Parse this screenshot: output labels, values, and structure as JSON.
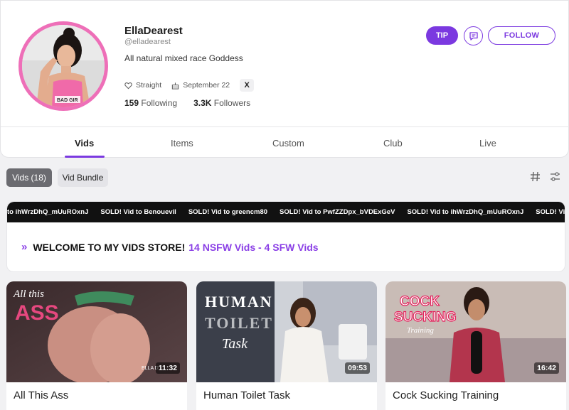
{
  "profile": {
    "name": "EllaDearest",
    "handle": "@elladearest",
    "bio": "All natural mixed race Goddess",
    "orientation": "Straight",
    "birthday": "September 22",
    "social": "X",
    "following_count": "159",
    "following_label": "Following",
    "followers_count": "3.3K",
    "followers_label": "Followers",
    "avatar_shirt_text": "BAD GIR"
  },
  "actions": {
    "tip": "TIP",
    "follow": "FOLLOW"
  },
  "tabs": [
    {
      "label": "Vids",
      "active": true
    },
    {
      "label": "Items"
    },
    {
      "label": "Custom"
    },
    {
      "label": "Club"
    },
    {
      "label": "Live"
    }
  ],
  "filters": {
    "vids": "Vids (18)",
    "bundle": "Vid Bundle"
  },
  "ticker": [
    "to ihWrzDhQ_mUuROxnJ",
    "SOLD! Vid to Benouevil",
    "SOLD! Vid to greencm80",
    "SOLD! Vid to PwfZZDpx_bVDExGeV",
    "SOLD! Vid to ihWrzDhQ_mUuROxnJ",
    "SOLD! Vid"
  ],
  "store": {
    "arrow": "»",
    "welcome": "WELCOME TO MY VIDS STORE!",
    "count": "14 NSFW Vids - 4 SFW Vids"
  },
  "cards": [
    {
      "title": "All This Ass",
      "duration": "11:32",
      "overlay1": "All this",
      "overlay2": "ASS",
      "watermark": "ELLA D"
    },
    {
      "title": "Human Toilet Task",
      "duration": "09:53",
      "overlay1": "HUMAN",
      "overlay2": "TOILET",
      "overlay3": "Task"
    },
    {
      "title": "Cock Sucking Training",
      "duration": "16:42",
      "overlay1": "COCK",
      "overlay2": "SUCKING",
      "overlay3": "Training"
    }
  ],
  "colors": {
    "accent": "#7b39e0",
    "avatar_ring": "#ee6fb8",
    "ticker_bg": "#111111"
  }
}
